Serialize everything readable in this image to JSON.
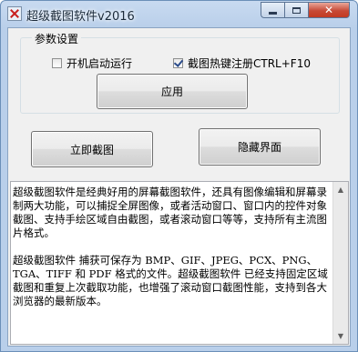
{
  "window": {
    "title": "超级截图软件v2016",
    "close_glyph": "✕"
  },
  "settings": {
    "group_label": "参数设置",
    "autostart": {
      "label": "开机启动运行",
      "checked": false
    },
    "hotkey": {
      "label": "截图热键注册CTRL+F10",
      "checked": true
    },
    "apply_label": "应用"
  },
  "actions": {
    "capture_label": "立即截图",
    "hide_label": "隐藏界面"
  },
  "description": {
    "text": "超级截图软件是经典好用的屏幕截图软件，还具有图像编辑和屏幕录制两大功能，可以捕捉全屏图像，或者活动窗口、窗口内的控件对象截图、支持手绘区域自由截图，或者滚动窗口等等，支持所有主流图片格式。\n\n超级截图软件 捕获可保存为 BMP、GIF、JPEG、PCX、PNG、TGA、TIFF 和 PDF 格式的文件。超级截图软件 已经支持固定区域截图和重复上次截取功能，也增强了滚动窗口截图性能，支持到各大浏览器的最新版本。"
  },
  "scrollbar": {
    "up_glyph": "▲",
    "down_glyph": "▼"
  }
}
